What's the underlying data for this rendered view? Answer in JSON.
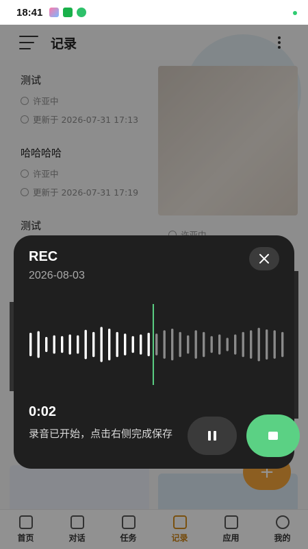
{
  "status_bar": {
    "time": "18:41"
  },
  "header": {
    "title": "记录"
  },
  "records": [
    {
      "title": "测试",
      "author": "许亚中",
      "updated": "更新于 2026-07-31 17:13"
    },
    {
      "title": "哈哈哈哈",
      "author": "许亚中",
      "updated": "更新于 2026-07-31 17:19"
    },
    {
      "title": "测试"
    }
  ],
  "right_card": {
    "author": "许亚中"
  },
  "fab": {
    "label": "+"
  },
  "nav": [
    {
      "label": "首页",
      "icon": "home-icon"
    },
    {
      "label": "对话",
      "icon": "chat-icon"
    },
    {
      "label": "任务",
      "icon": "task-icon"
    },
    {
      "label": "记录",
      "icon": "record-icon",
      "active": true
    },
    {
      "label": "应用",
      "icon": "apps-icon"
    },
    {
      "label": "我的",
      "icon": "profile-icon"
    }
  ],
  "recorder": {
    "label": "REC",
    "date": "2026-08-03",
    "elapsed": "0:02",
    "hint": "录音已开始，点击右侧完成保存",
    "levels": [
      0.28,
      0.32,
      0.18,
      0.22,
      0.2,
      0.24,
      0.22,
      0.35,
      0.3,
      0.42,
      0.38,
      0.3,
      0.26,
      0.2,
      0.24,
      0.28,
      0.26,
      0.34,
      0.38,
      0.3,
      0.22,
      0.34,
      0.3,
      0.2,
      0.24,
      0.16,
      0.24,
      0.3,
      0.34,
      0.4,
      0.36,
      0.34,
      0.3,
      0.22,
      0.26
    ],
    "playhead_index": 16
  },
  "colors": {
    "accent_green": "#5bd184",
    "nav_active": "#c97e10",
    "sheet_bg": "#1f1f1f"
  }
}
